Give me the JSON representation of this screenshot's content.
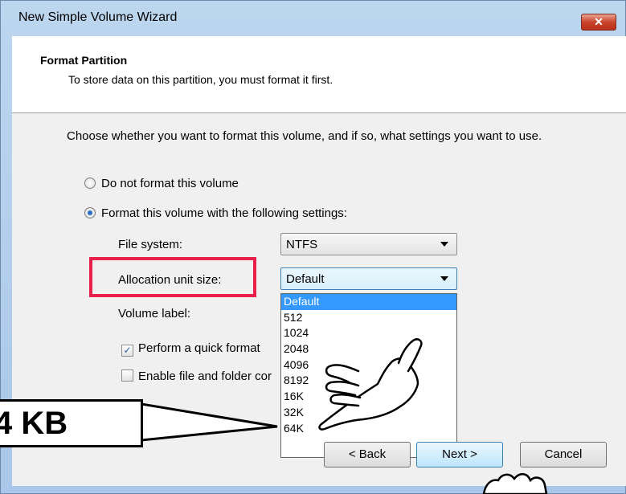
{
  "window": {
    "title": "New Simple Volume Wizard",
    "close_glyph": "✕"
  },
  "header": {
    "title": "Format Partition",
    "subtitle": "To store data on this partition, you must format it first."
  },
  "intro": "Choose whether you want to format this volume, and if so, what settings you want to use.",
  "options": {
    "do_not_format": "Do not format this volume",
    "format_with": "Format this volume with the following settings:"
  },
  "fields": {
    "file_system_label": "File system:",
    "file_system_value": "NTFS",
    "alloc_label": "Allocation unit size:",
    "alloc_value": "Default",
    "volume_label_label": "Volume label:",
    "quick_format_label": "Perform a quick format",
    "compression_label": "Enable file and folder cor"
  },
  "dropdown_options": [
    "Default",
    "512",
    "1024",
    "2048",
    "4096",
    "8192",
    "16K",
    "32K",
    "64K"
  ],
  "buttons": {
    "back": "< Back",
    "next": "Next >",
    "cancel": "Cancel"
  },
  "callout": "4 KB",
  "colors": {
    "highlight": "#3399ff",
    "annotation_box": "#e8204a"
  }
}
